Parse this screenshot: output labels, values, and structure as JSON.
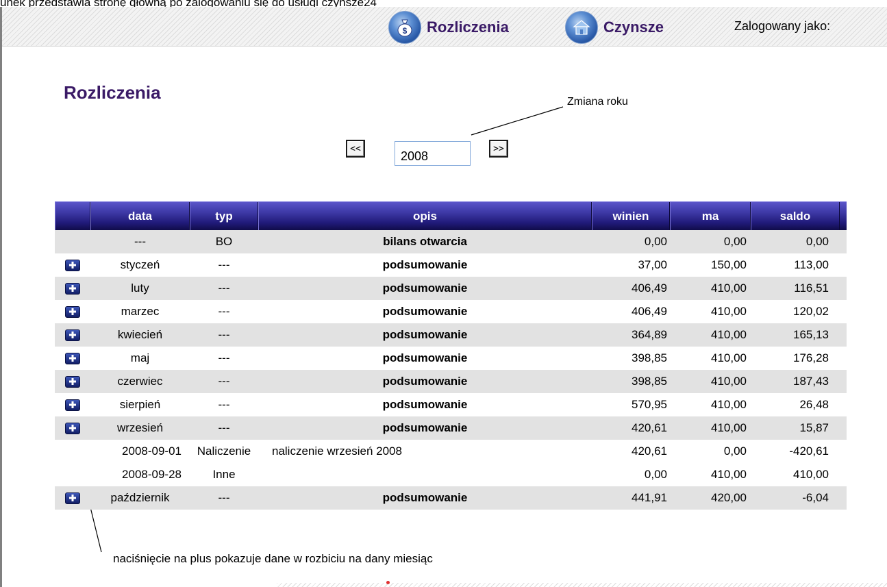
{
  "caption": "unek przedstawia stronę główną po zalogowaniu się do usługi czynsze24",
  "header": {
    "nav": [
      {
        "label": "Rozliczenia",
        "icon": "money-bag-icon"
      },
      {
        "label": "Czynsze",
        "icon": "house-icon"
      }
    ],
    "logged_as": "Zalogowany jako:"
  },
  "page_title": "Rozliczenia",
  "annotations": {
    "year_change": "Zmiana roku",
    "plus_hint": "naciśnięcie na plus pokazuje dane w rozbiciu na dany miesiąc"
  },
  "year_nav": {
    "prev_label": "<<",
    "next_label": ">>",
    "year": "2008"
  },
  "table": {
    "columns": [
      "",
      "data",
      "typ",
      "opis",
      "winien",
      "ma",
      "saldo"
    ],
    "rows": [
      {
        "kind": "summary",
        "shade": true,
        "expand": false,
        "data": "---",
        "typ": "BO",
        "opis": "bilans otwarcia",
        "winien": "0,00",
        "ma": "0,00",
        "saldo": "0,00"
      },
      {
        "kind": "summary",
        "shade": false,
        "expand": true,
        "data": "styczeń",
        "typ": "---",
        "opis": "podsumowanie",
        "winien": "37,00",
        "ma": "150,00",
        "saldo": "113,00"
      },
      {
        "kind": "summary",
        "shade": true,
        "expand": true,
        "data": "luty",
        "typ": "---",
        "opis": "podsumowanie",
        "winien": "406,49",
        "ma": "410,00",
        "saldo": "116,51"
      },
      {
        "kind": "summary",
        "shade": false,
        "expand": true,
        "data": "marzec",
        "typ": "---",
        "opis": "podsumowanie",
        "winien": "406,49",
        "ma": "410,00",
        "saldo": "120,02"
      },
      {
        "kind": "summary",
        "shade": true,
        "expand": true,
        "data": "kwiecień",
        "typ": "---",
        "opis": "podsumowanie",
        "winien": "364,89",
        "ma": "410,00",
        "saldo": "165,13"
      },
      {
        "kind": "summary",
        "shade": false,
        "expand": true,
        "data": "maj",
        "typ": "---",
        "opis": "podsumowanie",
        "winien": "398,85",
        "ma": "410,00",
        "saldo": "176,28"
      },
      {
        "kind": "summary",
        "shade": true,
        "expand": true,
        "data": "czerwiec",
        "typ": "---",
        "opis": "podsumowanie",
        "winien": "398,85",
        "ma": "410,00",
        "saldo": "187,43"
      },
      {
        "kind": "summary",
        "shade": false,
        "expand": true,
        "data": "sierpień",
        "typ": "---",
        "opis": "podsumowanie",
        "winien": "570,95",
        "ma": "410,00",
        "saldo": "26,48"
      },
      {
        "kind": "summary",
        "shade": true,
        "expand": true,
        "data": "wrzesień",
        "typ": "---",
        "opis": "podsumowanie",
        "winien": "420,61",
        "ma": "410,00",
        "saldo": "15,87"
      },
      {
        "kind": "detail",
        "shade": false,
        "expand": false,
        "data": "2008-09-01",
        "typ": "Naliczenie",
        "opis": "naliczenie wrzesień 2008",
        "winien": "420,61",
        "ma": "0,00",
        "saldo": "-420,61"
      },
      {
        "kind": "detail",
        "shade": false,
        "expand": false,
        "data": "2008-09-28",
        "typ": "Inne",
        "opis": "",
        "winien": "0,00",
        "ma": "410,00",
        "saldo": "410,00"
      },
      {
        "kind": "summary",
        "shade": true,
        "expand": true,
        "data": "październik",
        "typ": "---",
        "opis": "podsumowanie",
        "winien": "441,91",
        "ma": "420,00",
        "saldo": "-6,04"
      }
    ]
  }
}
